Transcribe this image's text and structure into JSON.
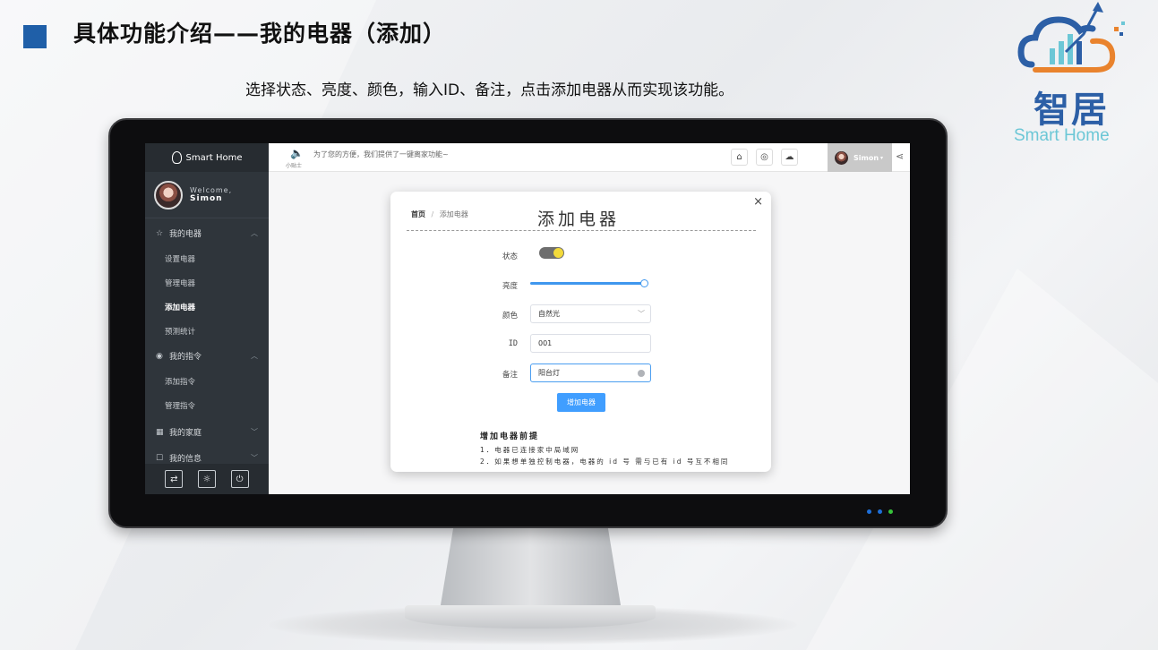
{
  "slide": {
    "title": "具体功能介绍——我的电器（添加）",
    "subtitle": "选择状态、亮度、颜色，输入ID、备注，点击添加电器从而实现该功能。"
  },
  "logo": {
    "text_cn": "智居",
    "text_en": "Smart Home"
  },
  "app": {
    "sidebar": {
      "brand": "Smart Home",
      "welcome": "Welcome,",
      "username": "Simon",
      "groups": [
        {
          "label": "我的电器",
          "icon": "star-icon",
          "items": [
            "设置电器",
            "管理电器",
            "添加电器",
            "预测统计"
          ]
        },
        {
          "label": "我的指令",
          "icon": "target-icon",
          "items": [
            "添加指令",
            "管理指令"
          ]
        },
        {
          "label": "我的家庭",
          "icon": "grid-icon",
          "items": []
        },
        {
          "label": "我的信息",
          "icon": "edit-icon",
          "items": []
        }
      ],
      "active_item": "添加电器",
      "footer_icons": [
        "swap-icon",
        "bulb-icon",
        "power-icon"
      ]
    },
    "topbar": {
      "tips_label": "小贴士",
      "notice": "为了您的方便，我们提供了一键离家功能~",
      "buttons": [
        "home-icon",
        "wifi-icon",
        "cloud-icon"
      ],
      "user": "Simon",
      "user_caret": "▾"
    },
    "modal": {
      "breadcrumb_home": "首页",
      "breadcrumb_sep": "/",
      "breadcrumb_current": "添加电器",
      "title": "添加电器",
      "close_symbol": "×",
      "fields": {
        "status_label": "状态",
        "status_on": true,
        "brightness_label": "亮度",
        "brightness_value": 1.0,
        "color_label": "颜色",
        "color_value": "自然光",
        "id_label": "ID",
        "id_value": "001",
        "note_label": "备注",
        "note_value": "阳台灯"
      },
      "submit_label": "增加电器",
      "notes_title": "增加电器前提",
      "notes": [
        "1．电器已连接家中局域网",
        "2．如果想单独控制电器，电器的 id 号 需与已有 id 号互不相同"
      ]
    }
  },
  "colors": {
    "title_square": "#1f5fa8",
    "accent_blue": "#409eff",
    "sidebar_bg": "#2f353b",
    "toggle_knob": "#f3da3b",
    "logo_blue": "#2c5fa6",
    "logo_cyan": "#6cc7d6",
    "logo_orange": "#e9832d"
  }
}
